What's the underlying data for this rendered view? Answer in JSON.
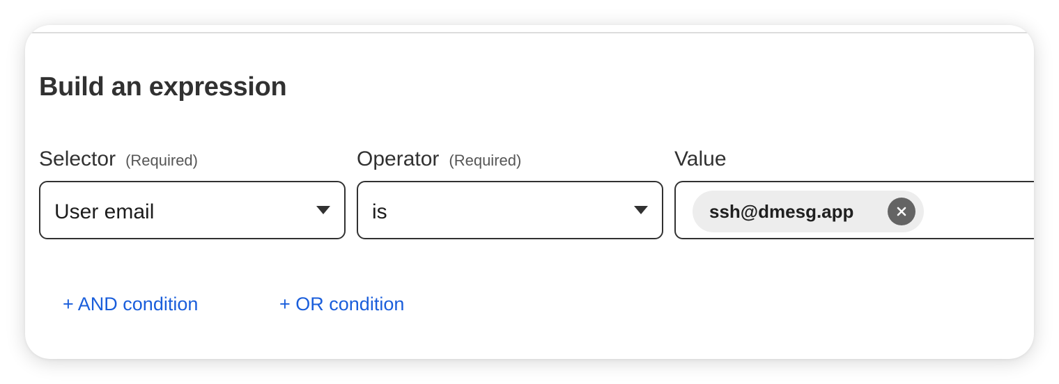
{
  "form": {
    "title": "Build an expression",
    "selector": {
      "label": "Selector",
      "required_text": "(Required)",
      "value": "User email"
    },
    "operator": {
      "label": "Operator",
      "required_text": "(Required)",
      "value": "is"
    },
    "value_field": {
      "label": "Value",
      "chips": [
        "ssh@dmesg.app"
      ]
    },
    "actions": {
      "and_label": "+ AND condition",
      "or_label": "+ OR condition"
    }
  },
  "icons": {
    "select_caret": "caret-down-icon",
    "chip_remove": "close-icon"
  },
  "colors": {
    "link": "#1a5edb",
    "text": "#313131",
    "border": "#313131",
    "chip_bg": "#ededed",
    "chip_remove_bg": "#646464"
  }
}
